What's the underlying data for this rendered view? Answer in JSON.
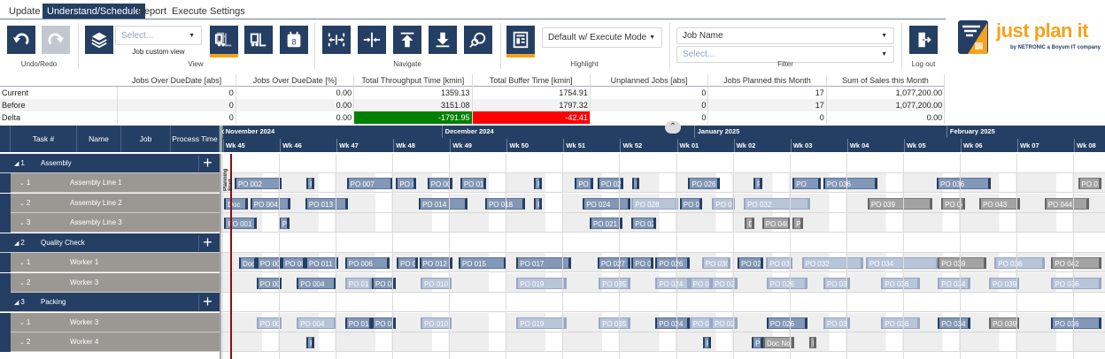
{
  "tabs": [
    "Update",
    "Understand/Schedule",
    "Report",
    "Execute",
    "Settings"
  ],
  "ribbon": {
    "undo_redo_label": "Undo/Redo",
    "view_label": "View",
    "view_select_placeholder": "Select...",
    "job_custom_view": "Job custom view",
    "navigate_label": "Navigate",
    "highlight_label": "Highlight",
    "highlight_value": "Default w/ Execute Mode",
    "filter_label": "Filter",
    "filter_field": "Job Name",
    "filter_placeholder": "Select...",
    "logout_label": "Log out",
    "accent": "#f7a21b",
    "button_color": "#243f63"
  },
  "logo": {
    "name": "just plan it",
    "tagline": "by NETRONIC a Boyum IT company"
  },
  "kpi": {
    "headers": [
      "",
      "Jobs Over DueDate [abs]",
      "Jobs Over DueDate [%]",
      "Total Throughput Time [kmin]",
      "Total Buffer Time [kmin]",
      "Unplanned Jobs [abs]",
      "Jobs Planned this Month",
      "Sum of Sales this Month"
    ],
    "rows": [
      [
        "Current",
        "0",
        "0.00",
        "1359.13",
        "1754.91",
        "0",
        "17",
        "1,077,200.00"
      ],
      [
        "Before",
        "0",
        "0.00",
        "3151.08",
        "1797.32",
        "0",
        "17",
        "1,077,200.00"
      ],
      [
        "Delta",
        "0",
        "0.00",
        "-1791.95",
        "-42.41",
        "0",
        "0",
        "0.00"
      ]
    ],
    "positive_color": "#008000",
    "negative_color": "#ff0000"
  },
  "gantt": {
    "columns": [
      "Task #",
      "Name",
      "Job",
      "Process Time"
    ],
    "months": [
      "November 2024",
      "December 2024",
      "January 2025",
      "February 2025"
    ],
    "weeks": [
      "Wk 45",
      "Wk 46",
      "Wk 47",
      "Wk 48",
      "Wk 49",
      "Wk 50",
      "Wk 51",
      "Wk 52",
      "Wk 01",
      "Wk 02",
      "Wk 03",
      "Wk 04",
      "Wk 05",
      "Wk 06",
      "Wk 07",
      "Wk 08"
    ],
    "marker_label": "Planning Start",
    "rows": [
      {
        "type": "g",
        "num": "1",
        "name": "Assembly"
      },
      {
        "type": "r",
        "num": "1",
        "name": "Assembly Line 1",
        "bars": [
          [
            "PO 002",
            0.2,
            0.83,
            "blue"
          ],
          [
            "PO",
            1.47,
            0.13,
            "blue"
          ],
          [
            "PO 007",
            2.18,
            0.82,
            "blue"
          ],
          [
            "PO 0",
            3.05,
            0.36,
            "blue"
          ],
          [
            "PO 008",
            3.6,
            0.45,
            "blue"
          ],
          [
            "PO 015",
            4.18,
            0.45,
            "blue"
          ],
          [
            "PO",
            5.48,
            0.14,
            "blue"
          ],
          [
            "PO",
            6.2,
            0.32,
            "blue"
          ],
          [
            "PO 022",
            6.6,
            0.45,
            "blue"
          ],
          [
            "PO",
            7.21,
            0.13,
            "blue"
          ],
          [
            "PO 026",
            8.2,
            0.55,
            "blue"
          ],
          [
            "PO",
            9.35,
            0.16,
            "blue"
          ],
          [
            "PO",
            10.04,
            0.5,
            "blue"
          ],
          [
            "PO 036",
            10.58,
            0.95,
            "blue"
          ],
          [
            "PO 036",
            12.58,
            0.95,
            "blue"
          ],
          [
            "PO 038",
            15.07,
            0.42,
            "gray"
          ]
        ]
      },
      {
        "type": "r",
        "num": "2",
        "name": "Assembly Line 2",
        "bars": [
          [
            "Doc",
            0.02,
            0.42,
            "blue"
          ],
          [
            "PO 004",
            0.48,
            0.7,
            "blue"
          ],
          [
            "PO 013",
            1.45,
            0.75,
            "blue"
          ],
          [
            "PO 014",
            3.45,
            0.86,
            "blue"
          ],
          [
            "PO 018",
            4.62,
            0.7,
            "blue"
          ],
          [
            "PO",
            5.48,
            0.14,
            "blue"
          ],
          [
            "PO 024",
            6.34,
            0.84,
            "blue"
          ],
          [
            "PO 028",
            7.2,
            0.82,
            "light"
          ],
          [
            "PO 030",
            8.05,
            0.4,
            "blue"
          ],
          [
            "PO 035",
            8.62,
            0.4,
            "light"
          ],
          [
            "PO 032",
            9.18,
            1.17,
            "light"
          ],
          [
            "PO 039",
            11.36,
            1.14,
            "gray"
          ],
          [
            "PO 040",
            12.66,
            0.42,
            "gray"
          ],
          [
            "PO 043",
            13.33,
            0.72,
            "gray"
          ],
          [
            "PO 044",
            14.48,
            0.78,
            "gray"
          ]
        ]
      },
      {
        "type": "r",
        "num": "3",
        "name": "Assembly Line 3",
        "bars": [
          [
            "PO 001",
            0.02,
            0.58,
            "blue"
          ],
          [
            "PO",
            0.98,
            0.19,
            "blue"
          ],
          [
            "PO 021",
            6.46,
            0.58,
            "blue"
          ],
          [
            "PO 026",
            7.2,
            0.44,
            "blue"
          ],
          [
            "Doc",
            9.2,
            0.16,
            "gray"
          ],
          [
            "PO 040",
            9.5,
            0.5,
            "gray"
          ],
          [
            "PO",
            10.04,
            0.19,
            "gray"
          ]
        ]
      },
      {
        "type": "g",
        "num": "2",
        "name": "Quality Check"
      },
      {
        "type": "r",
        "num": "1",
        "name": "Worker 1",
        "bars": [
          [
            "Doc",
            0.28,
            0.31,
            "blue"
          ],
          [
            "PO 009",
            0.59,
            0.44,
            "blue"
          ],
          [
            "PO 002",
            1.03,
            0.42,
            "blue"
          ],
          [
            "PO 011",
            1.45,
            0.58,
            "blue"
          ],
          [
            "PO 006",
            2.15,
            0.78,
            "blue"
          ],
          [
            "PO 007",
            3.06,
            0.38,
            "blue"
          ],
          [
            "PO 012",
            3.46,
            0.59,
            "blue"
          ],
          [
            "PO 015",
            4.15,
            0.84,
            "blue"
          ],
          [
            "PO 017",
            5.17,
            0.97,
            "blue"
          ],
          [
            "PO 027",
            6.6,
            0.58,
            "blue"
          ],
          [
            "PO 024",
            7.2,
            0.38,
            "blue"
          ],
          [
            "PO 026",
            7.62,
            0.6,
            "blue"
          ],
          [
            "PO 030",
            8.44,
            0.5,
            "light"
          ],
          [
            "PO 026",
            9.07,
            0.45,
            "blue"
          ],
          [
            "PO 031",
            9.57,
            0.47,
            "light"
          ],
          [
            "PO 032",
            10.2,
            1.09,
            "light"
          ],
          [
            "PO 034",
            11.33,
            1.28,
            "light"
          ],
          [
            "PO 039",
            12.6,
            0.86,
            "gray"
          ],
          [
            "PO 036",
            13.6,
            0.89,
            "light"
          ],
          [
            "PO 042",
            14.6,
            0.89,
            "gray"
          ]
        ]
      },
      {
        "type": "r",
        "num": "2",
        "name": "Worker 3",
        "bars": [
          [
            "PO 001",
            0.59,
            0.44,
            "blue"
          ],
          [
            "PO 004",
            1.3,
            0.7,
            "blue"
          ],
          [
            "PO 01",
            2.15,
            0.47,
            "light"
          ],
          [
            "PO 013",
            2.62,
            0.42,
            "blue"
          ],
          [
            "PO 010",
            3.48,
            0.55,
            "light"
          ],
          [
            "PO 019",
            5.17,
            0.89,
            "light"
          ],
          [
            "PO 035",
            6.62,
            0.56,
            "light"
          ],
          [
            "PO 024",
            7.62,
            0.6,
            "light"
          ],
          [
            "PO 028",
            8.22,
            0.39,
            "light"
          ],
          [
            "PO 029",
            8.6,
            0.47,
            "light"
          ],
          [
            "PO 026",
            9.58,
            0.72,
            "light"
          ],
          [
            "PO 033",
            10.58,
            0.47,
            "light"
          ],
          [
            "PO 036",
            11.6,
            0.69,
            "light"
          ],
          [
            "PO 034",
            12.6,
            0.58,
            "light"
          ],
          [
            "PO 039",
            13.5,
            0.53,
            "light"
          ],
          [
            "PO 036",
            14.6,
            0.89,
            "light"
          ]
        ]
      },
      {
        "type": "g",
        "num": "3",
        "name": "Packing"
      },
      {
        "type": "r",
        "num": "1",
        "name": "Worker 3",
        "bars": [
          [
            "PO 001",
            0.59,
            0.44,
            "light"
          ],
          [
            "PO 004",
            1.3,
            0.7,
            "light"
          ],
          [
            "PO 01",
            2.15,
            0.47,
            "blue"
          ],
          [
            "PO 013",
            2.62,
            0.42,
            "blue"
          ],
          [
            "PO 010",
            3.48,
            0.55,
            "light"
          ],
          [
            "PO 019",
            5.17,
            0.89,
            "light"
          ],
          [
            "PO 035",
            6.62,
            0.56,
            "light"
          ],
          [
            "PO 024",
            7.62,
            0.6,
            "blue"
          ],
          [
            "PO 028",
            8.22,
            0.39,
            "light"
          ],
          [
            "PO 029",
            8.6,
            0.47,
            "light"
          ],
          [
            "PO 026",
            9.58,
            0.72,
            "blue"
          ],
          [
            "PO 033",
            10.58,
            0.47,
            "light"
          ],
          [
            "PO 036",
            11.6,
            0.69,
            "light"
          ],
          [
            "PO 034",
            12.6,
            0.58,
            "blue"
          ],
          [
            "PO 039",
            13.5,
            0.53,
            "gray"
          ],
          [
            "PO 036",
            14.6,
            0.89,
            "blue"
          ]
        ]
      },
      {
        "type": "r",
        "num": "2",
        "name": "Worker 4",
        "bars": [
          [
            "PO",
            1.47,
            0.13,
            "blue"
          ],
          [
            "PO",
            8.46,
            0.14,
            "blue"
          ],
          [
            "PO",
            9.32,
            0.2,
            "blue"
          ],
          [
            "Doc No",
            9.52,
            0.55,
            "gray"
          ],
          [
            "PO",
            10.33,
            0.13,
            "gray"
          ]
        ]
      }
    ]
  }
}
